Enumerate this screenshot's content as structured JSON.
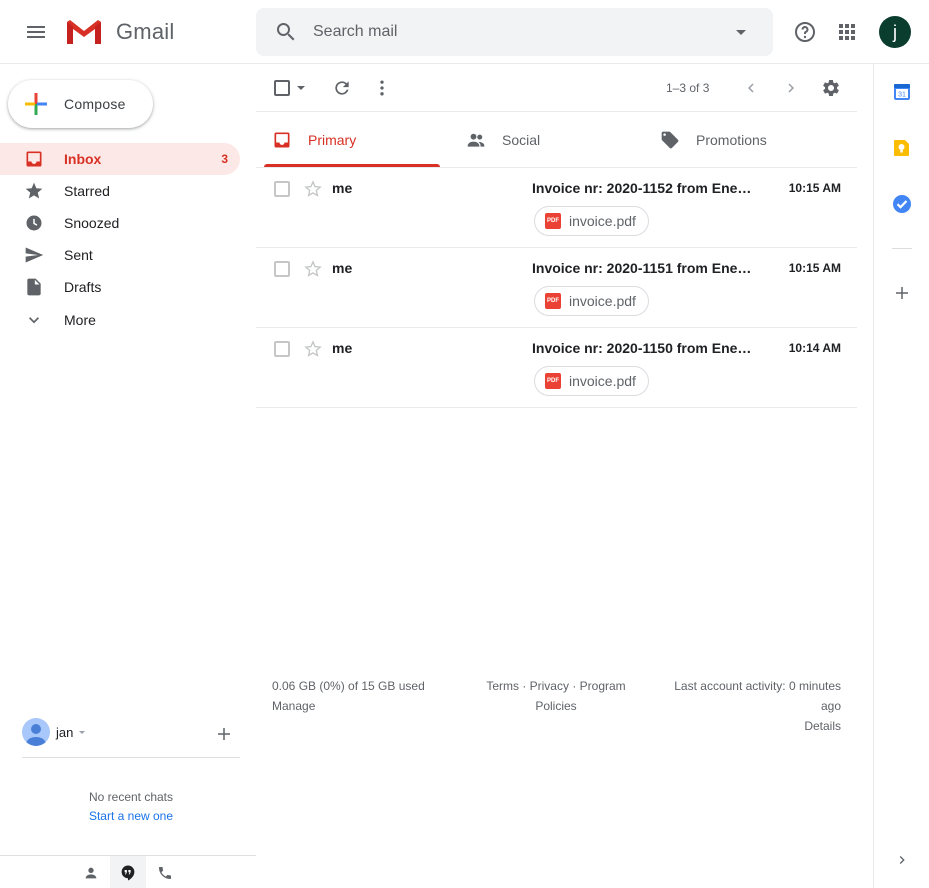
{
  "app": {
    "logo_text": "Gmail",
    "avatar_letter": "j"
  },
  "search": {
    "placeholder": "Search mail"
  },
  "compose": {
    "label": "Compose"
  },
  "nav": [
    {
      "label": "Inbox",
      "count": "3",
      "icon": "inbox-icon"
    },
    {
      "label": "Starred",
      "count": "",
      "icon": "star-icon"
    },
    {
      "label": "Snoozed",
      "count": "",
      "icon": "clock-icon"
    },
    {
      "label": "Sent",
      "count": "",
      "icon": "send-icon"
    },
    {
      "label": "Drafts",
      "count": "",
      "icon": "draft-icon"
    },
    {
      "label": "More",
      "count": "",
      "icon": "chevron-down-icon"
    }
  ],
  "hangouts": {
    "user": "jan",
    "empty_text": "No recent chats",
    "start_link": "Start a new one"
  },
  "toolbar": {
    "pagination": "1–3 of 3"
  },
  "tabs": [
    {
      "label": "Primary",
      "icon": "inbox-icon"
    },
    {
      "label": "Social",
      "icon": "people-icon"
    },
    {
      "label": "Promotions",
      "icon": "tag-icon"
    }
  ],
  "emails": [
    {
      "sender": "me",
      "subject": "Invoice nr: 2020-1152 from Ene…",
      "time": "10:15 AM",
      "attachment": "invoice.pdf"
    },
    {
      "sender": "me",
      "subject": "Invoice nr: 2020-1151 from Ene…",
      "time": "10:15 AM",
      "attachment": "invoice.pdf"
    },
    {
      "sender": "me",
      "subject": "Invoice nr: 2020-1150 from Ene…",
      "time": "10:14 AM",
      "attachment": "invoice.pdf"
    }
  ],
  "attachment_badge": "PDF",
  "footer": {
    "storage": "0.06 GB (0%) of 15 GB used",
    "manage": "Manage",
    "terms": "Terms · Privacy · Program",
    "policies": "Policies",
    "activity": "Last account activity: 0 minutes",
    "activity_ago": "ago",
    "details": "Details"
  },
  "side_panel": {
    "calendar_day": "31"
  },
  "colors": {
    "accent": "#d93025",
    "link": "#1a73e8",
    "avatar": "#0b3d2e"
  }
}
